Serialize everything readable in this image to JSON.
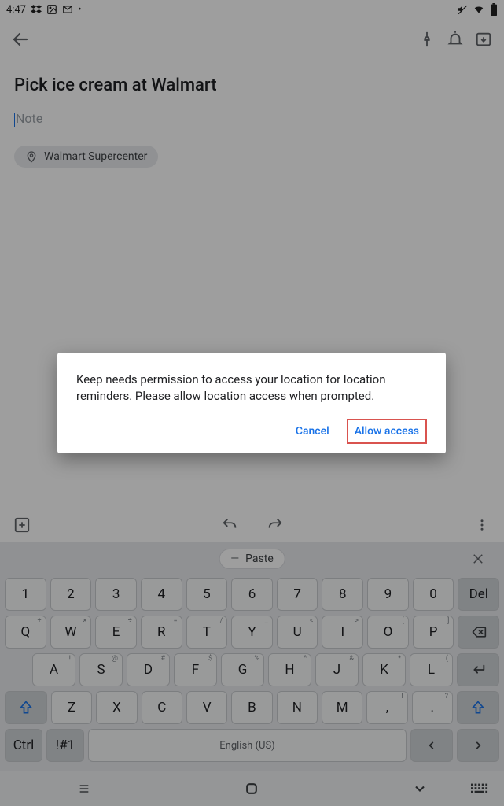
{
  "status": {
    "time": "4:47"
  },
  "note": {
    "title": "Pick ice cream at Walmart",
    "body_placeholder": "Note",
    "chip_label": "Walmart Supercenter"
  },
  "dialog": {
    "message": "Keep needs permission to access your location for location reminders. Please allow location access when prompted.",
    "cancel": "Cancel",
    "allow": "Allow access"
  },
  "suggest": {
    "paste": "Paste"
  },
  "keys": {
    "row1": [
      "1",
      "2",
      "3",
      "4",
      "5",
      "6",
      "7",
      "8",
      "9",
      "0",
      "Del"
    ],
    "row2": [
      "Q",
      "W",
      "E",
      "R",
      "T",
      "Y",
      "U",
      "I",
      "O",
      "P"
    ],
    "row2_sup": [
      "+",
      "×",
      "÷",
      "=",
      "/",
      "_",
      "<",
      ">",
      "[",
      "]"
    ],
    "row3": [
      "A",
      "S",
      "D",
      "F",
      "G",
      "H",
      "J",
      "K",
      "L"
    ],
    "row3_sup": [
      "!",
      "@",
      "#",
      "$",
      "%",
      "^",
      "&",
      "*",
      "("
    ],
    "row4": [
      "Z",
      "X",
      "C",
      "V",
      "B",
      "N",
      "M",
      ",",
      "."
    ],
    "row4_sup": [
      "",
      "",
      "",
      "",
      "",
      "",
      "",
      "!",
      "?"
    ],
    "ctrl": "Ctrl",
    "sym": "!#1",
    "space": "English (US)"
  }
}
